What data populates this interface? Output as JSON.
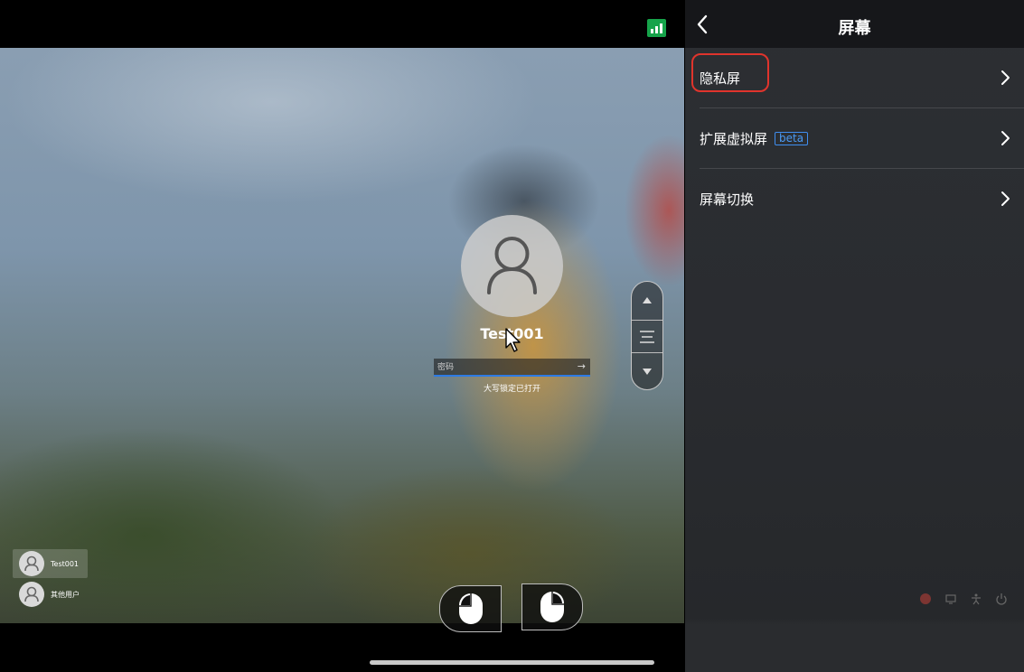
{
  "remote_screen": {
    "login": {
      "username": "Test001",
      "password_placeholder": "密码",
      "submit_arrow": "→",
      "capslock_notice": "大写锁定已打开"
    },
    "user_list": [
      {
        "name": "Test001",
        "selected": true
      },
      {
        "name": "其他用户",
        "selected": false
      }
    ],
    "scroll_control": {
      "up_icon": "triangle-up-icon",
      "menu_icon": "menu-lines-icon",
      "down_icon": "triangle-down-icon"
    },
    "mouse_buttons": [
      "left-mouse-button",
      "right-mouse-button"
    ],
    "signal_icon": "signal-bars-icon",
    "signal_color": "#16a34a"
  },
  "panel": {
    "title": "屏幕",
    "back_icon": "chevron-left-icon",
    "items": [
      {
        "label": "隐私屏",
        "highlighted": true
      },
      {
        "label": "扩展虚拟屏",
        "badge": "beta"
      },
      {
        "label": "屏幕切换"
      }
    ],
    "highlight_color": "#e0342c",
    "badge_color": "#3f8ef0"
  }
}
